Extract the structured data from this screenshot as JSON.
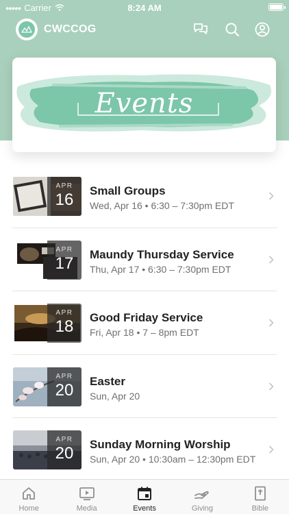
{
  "status_bar": {
    "carrier": "Carrier",
    "time": "8:24 AM"
  },
  "header": {
    "title": "CWCCOG"
  },
  "banner": {
    "title": "Events",
    "accent_color": "#7cc6a9"
  },
  "events": [
    {
      "title": "Small Groups",
      "subtitle": "Wed, Apr 16 • 6:30 – 7:30pm EDT",
      "month": "APR",
      "day": "16"
    },
    {
      "title": "Maundy Thursday Service",
      "subtitle": "Thu, Apr 17 • 6:30 – 7:30pm EDT",
      "month": "APR",
      "day": "17"
    },
    {
      "title": "Good Friday Service",
      "subtitle": "Fri, Apr 18 • 7 – 8pm EDT",
      "month": "APR",
      "day": "18"
    },
    {
      "title": "Easter",
      "subtitle": "Sun, Apr 20",
      "month": "APR",
      "day": "20"
    },
    {
      "title": "Sunday Morning Worship",
      "subtitle": "Sun, Apr 20 • 10:30am – 12:30pm EDT",
      "month": "APR",
      "day": "20"
    }
  ],
  "tabs": [
    {
      "label": "Home",
      "icon": "home-icon"
    },
    {
      "label": "Media",
      "icon": "media-icon"
    },
    {
      "label": "Events",
      "icon": "calendar-icon",
      "active": true
    },
    {
      "label": "Giving",
      "icon": "giving-icon"
    },
    {
      "label": "Bible",
      "icon": "bible-icon"
    }
  ],
  "colors": {
    "header_bg": "#a9d0bc",
    "accent": "#7cc6a9"
  }
}
